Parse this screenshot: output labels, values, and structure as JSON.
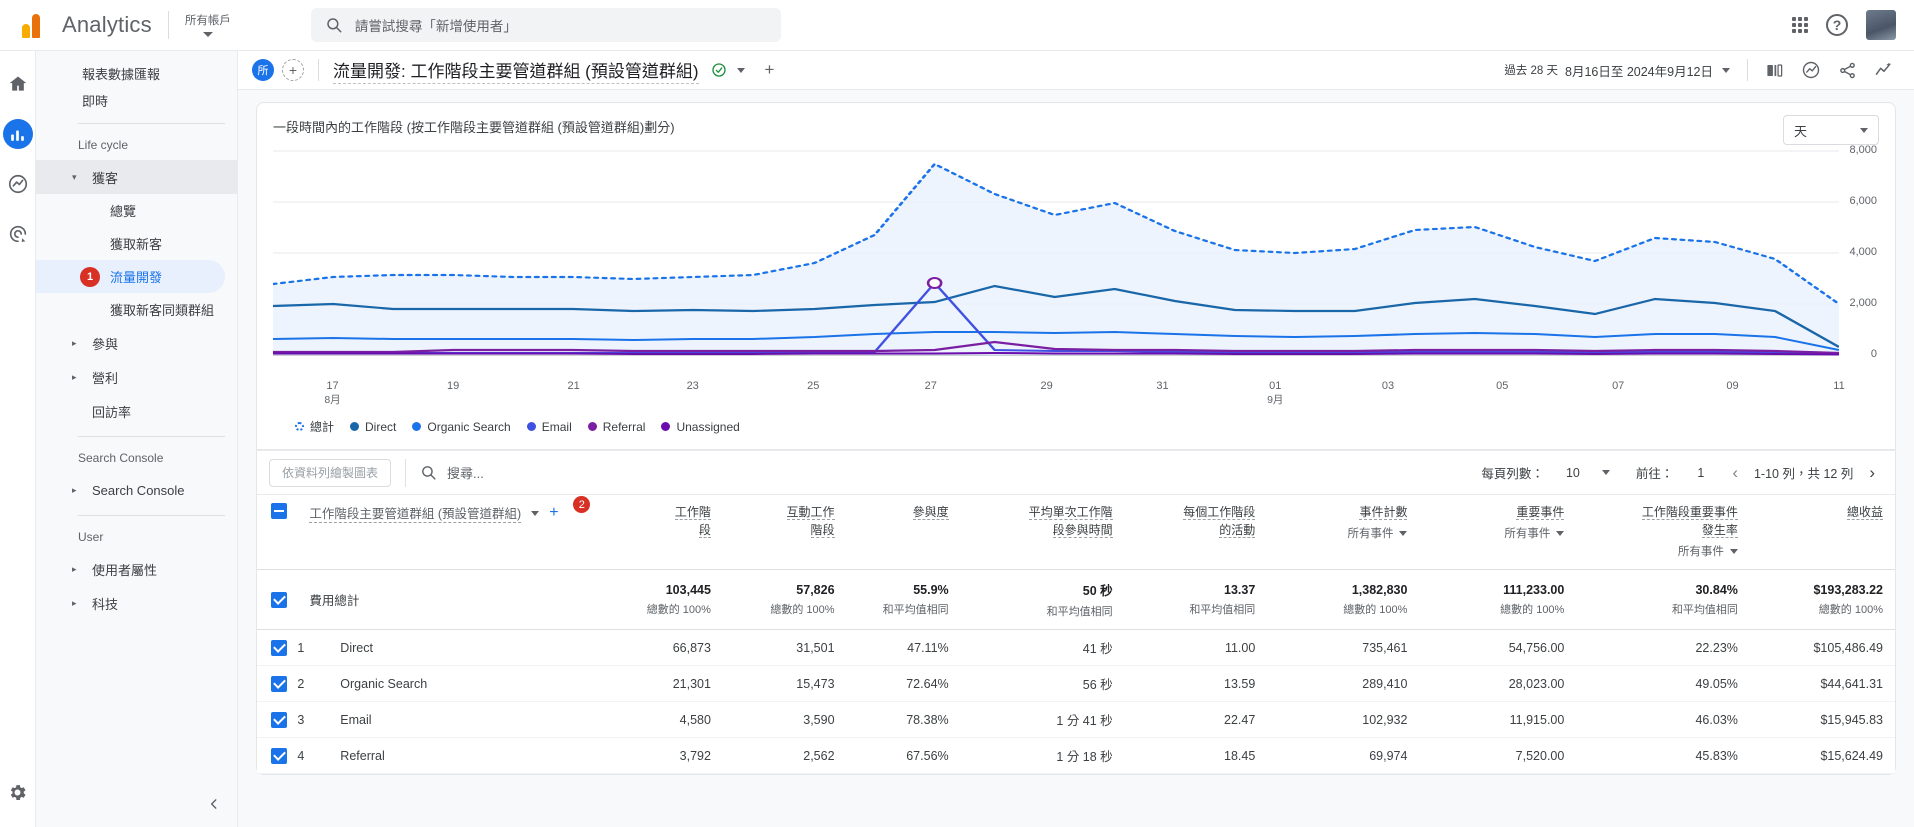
{
  "topbar": {
    "brand": "Analytics",
    "account_label": "所有帳戶",
    "search_placeholder": "請嘗試搜尋「新增使用者」",
    "apps_icon": "grid-apps-icon",
    "help_icon": "help-icon",
    "avatar": "user-avatar"
  },
  "rail": {
    "items": [
      {
        "name": "home",
        "icon": "home-icon"
      },
      {
        "name": "reports",
        "icon": "bar-chart-icon",
        "active": true
      },
      {
        "name": "explore",
        "icon": "explore-icon"
      },
      {
        "name": "advertising",
        "icon": "advertising-icon"
      }
    ],
    "settings_icon": "gear-icon"
  },
  "sidebar": {
    "top_items": [
      {
        "label": "報表數據匯報"
      },
      {
        "label": "即時"
      }
    ],
    "sections": [
      {
        "title": "Life cycle",
        "items": [
          {
            "label": "獲客",
            "expandable": true,
            "expanded": true,
            "selected": true
          },
          {
            "label": "總覽",
            "child": true
          },
          {
            "label": "獲取新客",
            "child": true
          },
          {
            "label": "流量開發",
            "child": true,
            "active": true,
            "badge": "1"
          },
          {
            "label": "獲取新客同類群組",
            "child": true
          },
          {
            "label": "參與",
            "expandable": true
          },
          {
            "label": "營利",
            "expandable": true
          },
          {
            "label": "回訪率"
          }
        ]
      },
      {
        "title": "Search Console",
        "items": [
          {
            "label": "Search Console",
            "expandable": true
          }
        ]
      },
      {
        "title": "User",
        "items": [
          {
            "label": "使用者屬性",
            "expandable": true
          },
          {
            "label": "科技",
            "expandable": true
          }
        ]
      }
    ],
    "collapse_icon": "chevron-left-icon"
  },
  "page_header": {
    "property_chip": "所",
    "add_comparison_icon": "plus-icon",
    "title": "流量開發: 工作階段主要管道群組 (預設管道群組)",
    "verified_icon": "check-circle-icon",
    "dropdown_icon": "chevron-down-icon",
    "add_icon": "plus-icon",
    "date_preset": "過去 28 天",
    "date_range": "8月16日至 2024年9月12日",
    "icons": [
      {
        "name": "compare-icon"
      },
      {
        "name": "insights-icon"
      },
      {
        "name": "share-icon"
      },
      {
        "name": "ai-insights-icon"
      }
    ]
  },
  "chart_card": {
    "title": "一段時間內的工作階段 (按工作階段主要管道群組 (預設管道群組)劃分)",
    "granularity": "天",
    "granularity_caret": "chevron-down-icon"
  },
  "chart_data": {
    "type": "line",
    "title": "一段時間內的工作階段 (按工作階段主要管道群組 (預設管道群組)劃分)",
    "xlabel": "",
    "ylabel": "",
    "ylim": [
      0,
      8000
    ],
    "yticks": [
      "0",
      "2,000",
      "4,000",
      "6,000",
      "8,000"
    ],
    "grid": true,
    "legend_position": "bottom",
    "x": [
      "17",
      "18",
      "19",
      "20",
      "21",
      "22",
      "23",
      "24",
      "25",
      "26",
      "27",
      "28",
      "29",
      "30",
      "31",
      "01",
      "02",
      "03",
      "04",
      "05",
      "06",
      "07",
      "08",
      "09",
      "10",
      "11",
      "12"
    ],
    "xtick_labels": [
      {
        "value": "17",
        "month": "8月"
      },
      {
        "value": "19"
      },
      {
        "value": "21"
      },
      {
        "value": "23"
      },
      {
        "value": "25"
      },
      {
        "value": "27"
      },
      {
        "value": "29"
      },
      {
        "value": "31"
      },
      {
        "value": "01",
        "month": "9月"
      },
      {
        "value": "03"
      },
      {
        "value": "05"
      },
      {
        "value": "07"
      },
      {
        "value": "09"
      },
      {
        "value": "11"
      }
    ],
    "series": [
      {
        "name": "總計",
        "color": "#1a73e8",
        "style": "dotted",
        "values": [
          2800,
          3000,
          3100,
          3100,
          3050,
          3050,
          3000,
          3050,
          3150,
          3600,
          4700,
          7500,
          6300,
          5500,
          5950,
          4850,
          4100,
          4000,
          4150,
          4900,
          5000,
          4250,
          3700,
          4600,
          4450,
          3750,
          2000
        ]
      },
      {
        "name": "Direct",
        "color": "#1967a8",
        "style": "solid",
        "values": [
          1900,
          2000,
          1800,
          1800,
          1800,
          1800,
          1700,
          1750,
          1700,
          1800,
          1950,
          2050,
          2700,
          2250,
          2600,
          2100,
          1750,
          1700,
          1700,
          2050,
          2200,
          1900,
          1600,
          2200,
          2050,
          1700,
          300
        ]
      },
      {
        "name": "Organic Search",
        "color": "#1a73e8",
        "style": "solid",
        "values": [
          600,
          650,
          620,
          620,
          620,
          620,
          600,
          620,
          640,
          700,
          800,
          900,
          900,
          850,
          900,
          800,
          750,
          720,
          740,
          820,
          850,
          800,
          700,
          820,
          800,
          700,
          180
        ]
      },
      {
        "name": "Email",
        "color": "#3f51e3",
        "style": "solid",
        "values": [
          80,
          90,
          90,
          90,
          90,
          90,
          85,
          90,
          90,
          100,
          110,
          2800,
          180,
          150,
          140,
          120,
          110,
          105,
          110,
          120,
          130,
          120,
          100,
          120,
          115,
          100,
          50
        ]
      },
      {
        "name": "Referral",
        "color": "#7b1fa2",
        "style": "solid",
        "values": [
          120,
          130,
          130,
          170,
          170,
          170,
          160,
          150,
          140,
          150,
          160,
          170,
          520,
          230,
          200,
          180,
          170,
          165,
          170,
          185,
          190,
          180,
          160,
          185,
          180,
          160,
          60
        ]
      },
      {
        "name": "Unassigned",
        "color": "#6a0dad",
        "style": "solid",
        "values": [
          60,
          60,
          60,
          60,
          60,
          60,
          55,
          55,
          55,
          60,
          60,
          65,
          70,
          65,
          60,
          60,
          55,
          55,
          55,
          60,
          60,
          60,
          55,
          60,
          60,
          55,
          30
        ]
      }
    ],
    "legend": [
      {
        "label": "總計",
        "color": "#1a73e8",
        "marker": "hollow-dotted"
      },
      {
        "label": "Direct",
        "color": "#1967a8",
        "marker": "dot"
      },
      {
        "label": "Organic Search",
        "color": "#1a73e8",
        "marker": "dot"
      },
      {
        "label": "Email",
        "color": "#3f51e3",
        "marker": "dot"
      },
      {
        "label": "Referral",
        "color": "#7b1fa2",
        "marker": "dot"
      },
      {
        "label": "Unassigned",
        "color": "#6a0dad",
        "marker": "dot"
      }
    ]
  },
  "table_toolbar": {
    "plot_rows_button": "依資料列繪製圖表",
    "search_icon": "search-icon",
    "search_placeholder": "搜尋...",
    "rows_per_page_label": "每頁列數：",
    "rows_per_page_value": "10",
    "goto_label": "前往：",
    "goto_value": "1",
    "range_text": "1-10 列，共 12 列",
    "prev_icon": "chevron-left-icon",
    "next_icon": "chevron-right-icon"
  },
  "table": {
    "dimension_header": "工作階段主要管道群組 (預設管道群組)",
    "dimension_caret": "chevron-down-icon",
    "dimension_add": "plus-icon",
    "metric_badge": "2",
    "columns": [
      {
        "label": "工作階\n段",
        "sub": ""
      },
      {
        "label": "互動工作\n階段",
        "sub": ""
      },
      {
        "label": "參與度",
        "sub": ""
      },
      {
        "label": "平均單次工作階\n段參與時間",
        "sub": ""
      },
      {
        "label": "每個工作階段\n的活動",
        "sub": ""
      },
      {
        "label": "事件計數",
        "sub": "所有事件"
      },
      {
        "label": "重要事件",
        "sub": "所有事件"
      },
      {
        "label": "工作階段重要事件\n發生率",
        "sub": "所有事件"
      },
      {
        "label": "總收益",
        "sub": ""
      }
    ],
    "total_row": {
      "label": "費用總計",
      "values": [
        "103,445",
        "57,826",
        "55.9%",
        "50 秒",
        "13.37",
        "1,382,830",
        "111,233.00",
        "30.84%",
        "$193,283.22"
      ],
      "subs": [
        "總數的 100%",
        "總數的 100%",
        "和平均值相同",
        "和平均值相同",
        "和平均值相同",
        "總數的 100%",
        "總數的 100%",
        "和平均值相同",
        "總數的 100%"
      ]
    },
    "rows": [
      {
        "index": "1",
        "name": "Direct",
        "values": [
          "66,873",
          "31,501",
          "47.11%",
          "41 秒",
          "11.00",
          "735,461",
          "54,756.00",
          "22.23%",
          "$105,486.49"
        ]
      },
      {
        "index": "2",
        "name": "Organic Search",
        "values": [
          "21,301",
          "15,473",
          "72.64%",
          "56 秒",
          "13.59",
          "289,410",
          "28,023.00",
          "49.05%",
          "$44,641.31"
        ]
      },
      {
        "index": "3",
        "name": "Email",
        "values": [
          "4,580",
          "3,590",
          "78.38%",
          "1 分 41 秒",
          "22.47",
          "102,932",
          "11,915.00",
          "46.03%",
          "$15,945.83"
        ]
      },
      {
        "index": "4",
        "name": "Referral",
        "values": [
          "3,792",
          "2,562",
          "67.56%",
          "1 分 18 秒",
          "18.45",
          "69,974",
          "7,520.00",
          "45.83%",
          "$15,624.49"
        ]
      }
    ]
  }
}
